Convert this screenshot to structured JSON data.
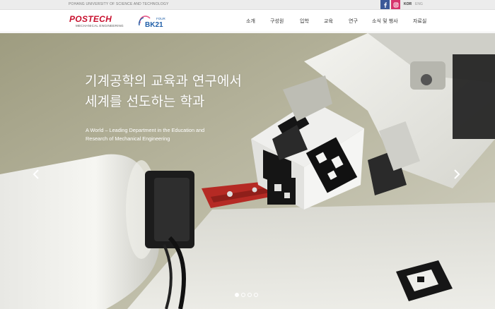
{
  "utility_bar": {
    "university_name": "POHANG UNIVERSITY OF SCIENCE AND TECHNOLOGY",
    "social": [
      {
        "name": "facebook-icon",
        "glyph": "f"
      },
      {
        "name": "instagram-icon",
        "glyph": "◎"
      }
    ],
    "lang_kor": "KOR",
    "lang_eng": "ENG"
  },
  "header": {
    "logo_title": "POSTECH",
    "logo_subtitle": "MECHANICAL ENGINEERING",
    "bk_logo_text": "BK",
    "bk_logo_number": "21",
    "bk_logo_four": "FOUR",
    "nav": [
      "소개",
      "구성원",
      "입학",
      "교육",
      "연구",
      "소식 및 행사",
      "자료실"
    ]
  },
  "hero": {
    "headline_line1": "기계공학의 교육과 연구에서",
    "headline_line2": "세계를 선도하는 학과",
    "subtext_line1": "A World – Leading Department in the Education and",
    "subtext_line2": "Research of Mechanical Engineering",
    "slide_count": 4,
    "active_slide": 1
  },
  "colors": {
    "brand_red": "#c8102e",
    "bk_blue": "#1f5ea8",
    "facebook": "#3b5998",
    "instagram": "#d6336c",
    "robot_link_red": "#b52a24"
  }
}
